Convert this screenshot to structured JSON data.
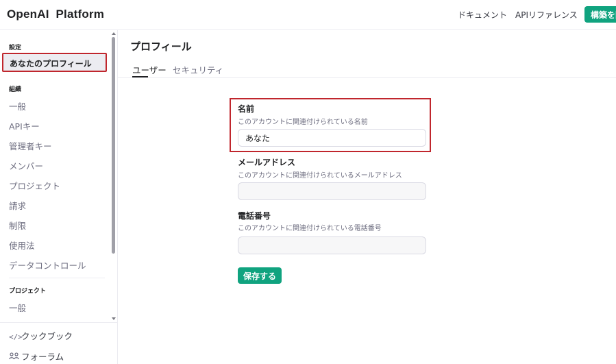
{
  "header": {
    "brand": "OpenAI  Platform",
    "nav": [
      "ドキュメント",
      "APIリファレンス"
    ],
    "build_button": "構築を開"
  },
  "sidebar": {
    "sections": [
      {
        "title": "設定",
        "items": [
          "あなたのプロフィール"
        ]
      },
      {
        "title": "組織",
        "items": [
          "一般",
          "APIキー",
          "管理者キー",
          "メンバー",
          "プロジェクト",
          "請求",
          "制限",
          "使用法",
          "データコントロール"
        ]
      },
      {
        "title": "プロジェクト",
        "items": [
          "一般"
        ]
      }
    ],
    "active_item": "あなたのプロフィール",
    "bottom_links": [
      {
        "icon": "code-icon",
        "label": "クックブック"
      },
      {
        "icon": "people-icon",
        "label": "フォーラム"
      }
    ]
  },
  "main": {
    "title": "プロフィール",
    "tabs": [
      "ユーザー",
      "セキュリティ"
    ],
    "active_tab": "ユーザー",
    "fields": [
      {
        "label": "名前",
        "description": "このアカウントに関連付けられている名前",
        "value": "あなた",
        "placeholder": ""
      },
      {
        "label": "メールアドレス",
        "description": "このアカウントに関連付けられているメールアドレス",
        "value": "",
        "placeholder": ""
      },
      {
        "label": "電話番号",
        "description": "このアカウントに関連付けられている電話番号",
        "value": "",
        "placeholder": ""
      }
    ],
    "save_button": "保存する"
  },
  "colors": {
    "accent": "#10a37f",
    "highlight": "#c0262d",
    "active_bg": "#ececf1"
  }
}
